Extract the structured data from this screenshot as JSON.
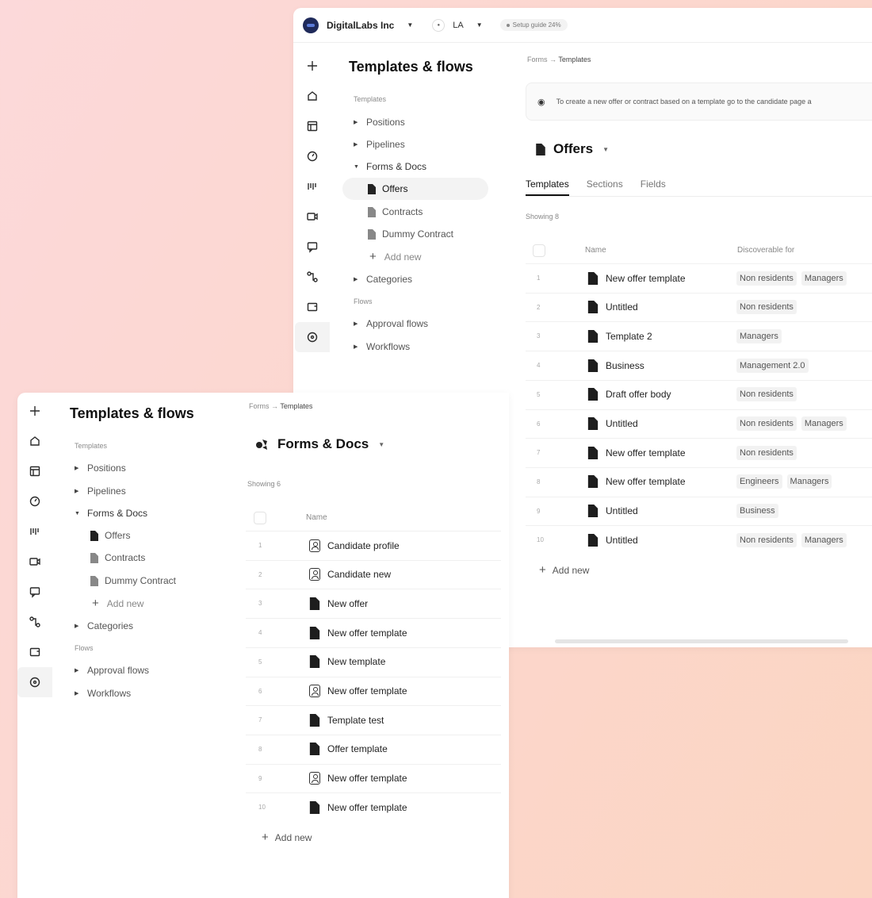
{
  "window_a": {
    "topbar": {
      "org_name": "DigitalLabs Inc",
      "location": "LA",
      "setup_label": "Setup guide 24%"
    },
    "sidebar": {
      "title": "Templates & flows",
      "section_templates": "Templates",
      "section_flows": "Flows",
      "items": {
        "positions": "Positions",
        "pipelines": "Pipelines",
        "forms_docs": "Forms & Docs",
        "offers": "Offers",
        "contracts": "Contracts",
        "dummy_contract": "Dummy Contract",
        "add_new": "Add new",
        "categories": "Categories",
        "approval_flows": "Approval flows",
        "workflows": "Workflows"
      }
    },
    "breadcrumb": {
      "parent": "Forms",
      "current": "Templates"
    },
    "notice": "To create a new offer or contract based on a template go to the candidate page a",
    "title": "Offers",
    "tabs": [
      "Templates",
      "Sections",
      "Fields"
    ],
    "showing": "Showing 8",
    "columns": {
      "name": "Name",
      "discoverable": "Discoverable for"
    },
    "rows": [
      {
        "num": "1",
        "name": "New offer template",
        "tags": [
          "Non residents",
          "Managers"
        ]
      },
      {
        "num": "2",
        "name": "Untitled",
        "tags": [
          "Non residents"
        ]
      },
      {
        "num": "3",
        "name": "Template 2",
        "tags": [
          "Managers"
        ]
      },
      {
        "num": "4",
        "name": "Business",
        "tags": [
          "Management 2.0"
        ]
      },
      {
        "num": "5",
        "name": "Draft offer body",
        "tags": [
          "Non residents"
        ]
      },
      {
        "num": "6",
        "name": "Untitled",
        "tags": [
          "Non residents",
          "Managers"
        ]
      },
      {
        "num": "7",
        "name": "New offer template",
        "tags": [
          "Non residents"
        ]
      },
      {
        "num": "8",
        "name": "New offer template",
        "tags": [
          "Engineers",
          "Managers"
        ]
      },
      {
        "num": "9",
        "name": "Untitled",
        "tags": [
          "Business"
        ]
      },
      {
        "num": "10",
        "name": "Untitled",
        "tags": [
          "Non residents",
          "Managers"
        ]
      }
    ],
    "add_new": "Add new"
  },
  "window_b": {
    "sidebar": {
      "title": "Templates & flows",
      "section_templates": "Templates",
      "section_flows": "Flows",
      "items": {
        "positions": "Positions",
        "pipelines": "Pipelines",
        "forms_docs": "Forms & Docs",
        "offers": "Offers",
        "contracts": "Contracts",
        "dummy_contract": "Dummy Contract",
        "add_new": "Add new",
        "categories": "Categories",
        "approval_flows": "Approval flows",
        "workflows": "Workflows"
      }
    },
    "breadcrumb": {
      "parent": "Forms",
      "current": "Templates"
    },
    "title": "Forms & Docs",
    "showing": "Showing 6",
    "columns": {
      "name": "Name"
    },
    "rows": [
      {
        "num": "1",
        "name": "Candidate profile",
        "icon": "person-card-icon"
      },
      {
        "num": "2",
        "name": "Candidate new",
        "icon": "person-card-icon"
      },
      {
        "num": "3",
        "name": "New offer",
        "icon": "document-icon"
      },
      {
        "num": "4",
        "name": "New offer template",
        "icon": "document-icon"
      },
      {
        "num": "5",
        "name": "New template",
        "icon": "document-icon"
      },
      {
        "num": "6",
        "name": "New offer template",
        "icon": "person-card-icon"
      },
      {
        "num": "7",
        "name": "Template test",
        "icon": "document-icon"
      },
      {
        "num": "8",
        "name": "Offer template",
        "icon": "document-icon"
      },
      {
        "num": "9",
        "name": "New offer template",
        "icon": "person-card-icon"
      },
      {
        "num": "10",
        "name": "New offer template",
        "icon": "document-icon"
      }
    ],
    "add_new": "Add new"
  }
}
